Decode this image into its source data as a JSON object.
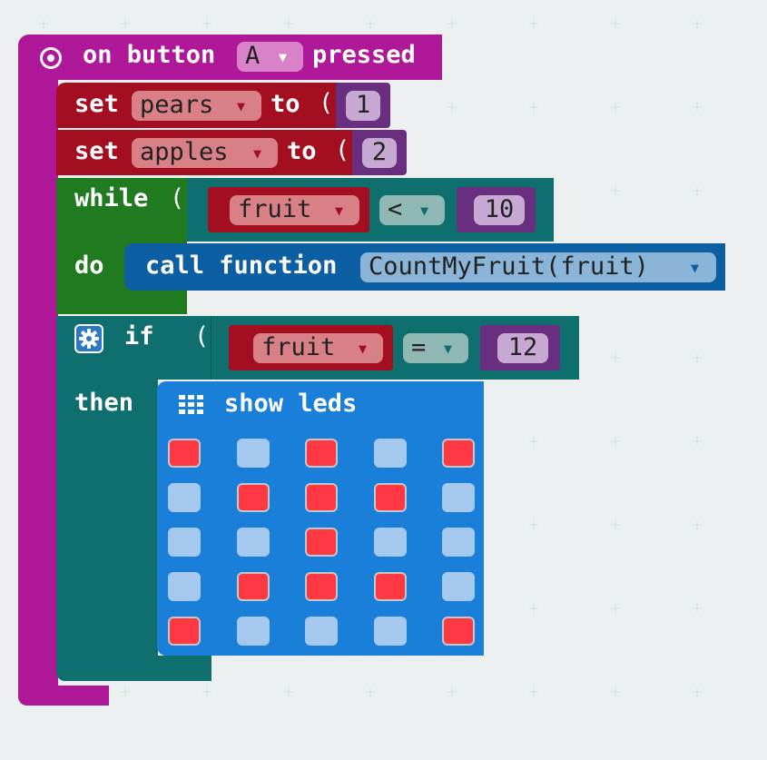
{
  "event": {
    "prefix": "on button",
    "button": "A",
    "suffix": "pressed"
  },
  "set1": {
    "keyword": "set",
    "variable": "pears",
    "to": "to",
    "value": "1"
  },
  "set2": {
    "keyword": "set",
    "variable": "apples",
    "to": "to",
    "value": "2"
  },
  "while_block": {
    "while_label": "while",
    "do_label": "do",
    "condition": {
      "variable": "fruit",
      "operator": "<",
      "value": "10"
    },
    "call": {
      "label": "call function",
      "function": "CountMyFruit(fruit)"
    }
  },
  "if_block": {
    "if_label": "if",
    "then_label": "then",
    "condition": {
      "variable": "fruit",
      "operator": "=",
      "value": "12"
    }
  },
  "show_leds": {
    "label": "show leds",
    "grid": [
      [
        1,
        0,
        1,
        0,
        1
      ],
      [
        0,
        1,
        1,
        1,
        0
      ],
      [
        0,
        0,
        1,
        0,
        0
      ],
      [
        0,
        1,
        1,
        1,
        0
      ],
      [
        1,
        0,
        0,
        0,
        1
      ]
    ]
  },
  "dropdown_arrow": "▼",
  "colors": {
    "event": "#b0189a",
    "variables": "#a30f21",
    "math": "#6a2e80",
    "loops": "#0f6f6f",
    "do_body": "#207a1f",
    "functions": "#0d5fa3",
    "leds": "#1a7fd8",
    "led_on": "#ff3944",
    "led_off": "#a4c8ee"
  }
}
